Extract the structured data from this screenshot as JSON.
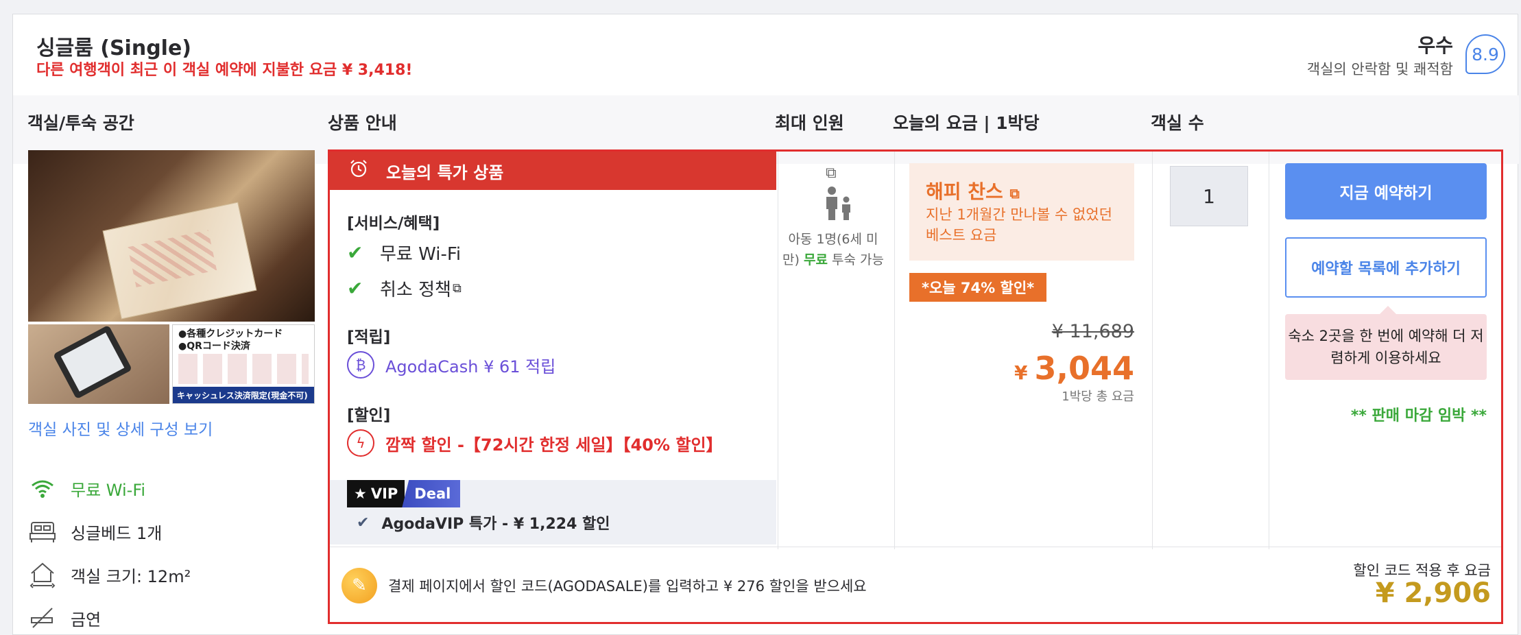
{
  "room": {
    "title": "싱글룸 (Single)",
    "recent_booking": "다른 여행객이 최근 이 객실 예약에 지불한 요금 ¥ 3,418!"
  },
  "rating": {
    "word": "우수",
    "subtitle": "객실의 안락함 및 쾌적함",
    "score": "8.9"
  },
  "columns": {
    "room": "객실/투숙 공간",
    "offer": "상품 안내",
    "occupancy": "최대 인원",
    "price": "오늘의 요금 | 1박당",
    "rooms": "객실 수"
  },
  "photos": {
    "link": "객실 사진 및 상세 구성 보기",
    "pay_line1": "●各種クレジットカード",
    "pay_line2": "●QRコード決済",
    "pay_bar": "キャッシュレス決済限定(現金不可)"
  },
  "amenities": [
    {
      "label": "무료 Wi-Fi",
      "icon": "wifi-icon",
      "color": "#3aa83a"
    },
    {
      "label": "싱글베드 1개",
      "icon": "bed-icon"
    },
    {
      "label": "객실 크기: 12m²",
      "icon": "house-icon"
    },
    {
      "label": "금연",
      "icon": "no-smoking-icon"
    }
  ],
  "offer": {
    "banner": "오늘의 특가 상품",
    "services_label": "[서비스/혜택]",
    "services": [
      "무료 Wi-Fi",
      "취소 정책"
    ],
    "points_label": "[적립]",
    "points": "AgodaCash ¥ 61 적립",
    "discount_label": "[할인]",
    "discount": "깜짝 할인 -【72시간 한정 세일】【40% 할인】",
    "vip_a": "VIP",
    "vip_b": "Deal",
    "vip_text": "AgodaVIP 특가 - ¥ 1,224 할인"
  },
  "occupancy": {
    "text_a": "아동 1명(6세 미만) ",
    "text_free": "무료",
    "text_b": " 투숙 가능"
  },
  "price": {
    "happy_title": "해피 찬스",
    "happy_desc": "지난 1개월간 만나볼 수 없었던 베스트 요금",
    "today_badge": "*오늘 74% 할인*",
    "old": "¥ 11,689",
    "currency": "¥",
    "new": "3,044",
    "per_night": "1박당 총 요금"
  },
  "quantity": "1",
  "actions": {
    "book": "지금 예약하기",
    "add_list": "예약할 목록에 추가하기",
    "tip": "숙소 2곳을 한 번에 예약해 더 저렴하게 이용하세요",
    "soldout": "** 판매 마감 임박 **"
  },
  "coupon": {
    "text": "결제 페이지에서 할인 코드(AGODASALE)를 입력하고 ¥ 276 할인을 받으세요",
    "after_label": "할인 코드 적용 후 요금",
    "after_price": "¥ 2,906"
  },
  "colors": {
    "accent_red": "#e12d2d",
    "accent_blue": "#5a8ff0",
    "accent_orange": "#e8702a",
    "accent_green": "#3aa83a",
    "accent_gold": "#c49a1e"
  }
}
